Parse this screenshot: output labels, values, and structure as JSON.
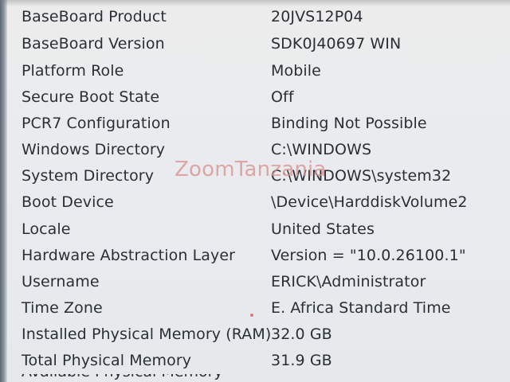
{
  "watermark": "ZoomTanzania",
  "rows": [
    {
      "label": "BaseBoard Product",
      "value": "20JVS12P04"
    },
    {
      "label": "BaseBoard Version",
      "value": "SDK0J40697 WIN"
    },
    {
      "label": "Platform Role",
      "value": "Mobile"
    },
    {
      "label": "Secure Boot State",
      "value": "Off"
    },
    {
      "label": "PCR7 Configuration",
      "value": "Binding Not Possible"
    },
    {
      "label": "Windows Directory",
      "value": "C:\\WINDOWS"
    },
    {
      "label": "System Directory",
      "value": "C:\\WINDOWS\\system32"
    },
    {
      "label": "Boot Device",
      "value": "\\Device\\HarddiskVolume2"
    },
    {
      "label": "Locale",
      "value": "United States"
    },
    {
      "label": "Hardware Abstraction Layer",
      "value": "Version = \"10.0.26100.1\""
    },
    {
      "label": "Username",
      "value": "ERICK\\Administrator"
    },
    {
      "label": "Time Zone",
      "value": "E. Africa Standard Time"
    },
    {
      "label": "Installed Physical Memory (RAM)",
      "value": "32.0 GB"
    },
    {
      "label": "Total Physical Memory",
      "value": "31.9 GB"
    }
  ],
  "partial_row": {
    "label": "Available Physical Memory"
  }
}
